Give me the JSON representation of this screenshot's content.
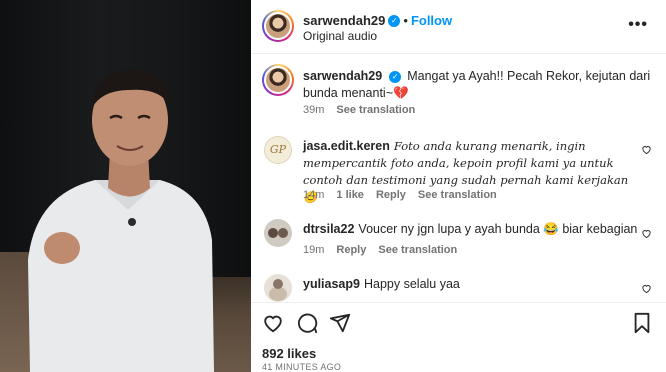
{
  "post": {
    "username": "sarwendah29",
    "follow_label": "Follow",
    "audio": "Original audio",
    "caption": "Mangat ya Ayah!! Pecah Rekor, kejutan dari bunda menanti~💔",
    "caption_time": "39m",
    "see_translation": "See translation"
  },
  "comments": [
    {
      "username": "jasa.edit.keren",
      "text": "Foto anda kurang menarik, ingin mempercantik foto anda, kepoin profil kami ya untuk contoh dan testimoni yang sudah pernah kami kerjakan 😊",
      "time": "14m",
      "likes": "1 like",
      "reply": "Reply",
      "translate": "See translation",
      "avatar_text": "GP"
    },
    {
      "username": "dtrsila22",
      "text": "Voucer ny jgn lupa y ayah bunda 😂 biar kebagian",
      "time": "19m",
      "reply": "Reply",
      "translate": "See translation"
    },
    {
      "username": "yuliasap9",
      "text": "Happy selalu yaa"
    }
  ],
  "footer": {
    "likes": "892 likes",
    "timestamp": "41 MINUTES AGO"
  },
  "icons": {
    "verified": "verified-badge-icon",
    "more": "more-options-icon",
    "heart": "heart-icon",
    "comment": "comment-icon",
    "share": "share-icon",
    "bookmark": "bookmark-icon"
  },
  "colors": {
    "accent": "#0095f6",
    "text": "#262626",
    "muted": "#737373"
  }
}
